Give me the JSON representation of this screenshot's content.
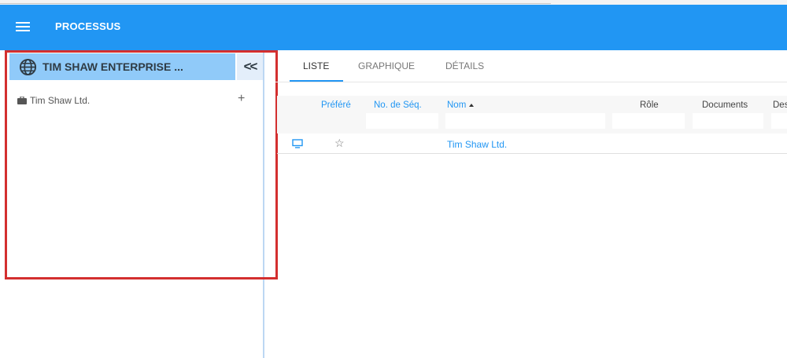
{
  "header": {
    "title": "PROCESSUS",
    "menu_icon": "hamburger-menu-icon",
    "bar_color": "#2196f3"
  },
  "sidebar": {
    "enterprise": {
      "name": "TIM SHAW ENTERPRISE ...",
      "icon": "globe-icon",
      "bg_color": "#90caf9"
    },
    "collapse_label": "<<",
    "tree": [
      {
        "label": "Tim Shaw Ltd.",
        "icon": "briefcase-icon",
        "action_label": "+"
      }
    ],
    "highlight_color": "#d32f2f"
  },
  "tabs": [
    {
      "label": "LISTE",
      "active": true
    },
    {
      "label": "GRAPHIQUE",
      "active": false
    },
    {
      "label": "DÉTAILS",
      "active": false
    }
  ],
  "table": {
    "columns": [
      {
        "label": "Préféré"
      },
      {
        "label": "No. de Séq."
      },
      {
        "label": "Nom",
        "sorted": "ascending"
      },
      {
        "label": "Rôle"
      },
      {
        "label": "Documents"
      },
      {
        "label": "Des"
      }
    ],
    "rows": [
      {
        "view_icon": "monitor-icon",
        "favorite_icon": "star-outline-icon",
        "name": "Tim Shaw Ltd."
      }
    ]
  }
}
